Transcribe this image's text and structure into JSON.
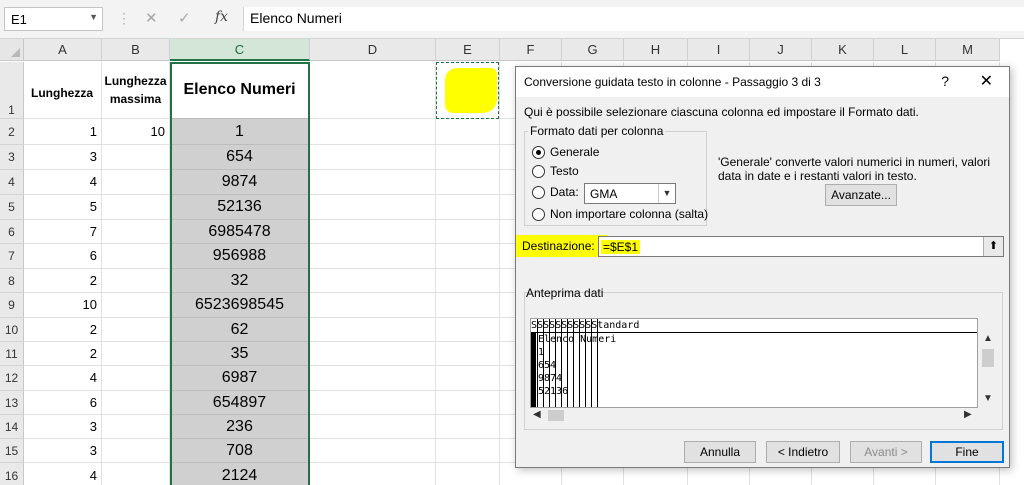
{
  "formula_bar": {
    "name_box": "E1",
    "content": "Elenco Numeri",
    "fx": "fx"
  },
  "columns": [
    "A",
    "B",
    "C",
    "D",
    "E",
    "F",
    "G",
    "H",
    "I",
    "J",
    "K",
    "L",
    "M"
  ],
  "rows": [
    {
      "n": "1",
      "a": "Lunghezza",
      "b": "Lunghezza massima",
      "c": "Elenco Numeri"
    },
    {
      "n": "2",
      "a": "1",
      "b": "10",
      "c": "1"
    },
    {
      "n": "3",
      "a": "3",
      "b": "",
      "c": "654"
    },
    {
      "n": "4",
      "a": "4",
      "b": "",
      "c": "9874"
    },
    {
      "n": "5",
      "a": "5",
      "b": "",
      "c": "52136"
    },
    {
      "n": "6",
      "a": "7",
      "b": "",
      "c": "6985478"
    },
    {
      "n": "7",
      "a": "6",
      "b": "",
      "c": "956988"
    },
    {
      "n": "8",
      "a": "2",
      "b": "",
      "c": "32"
    },
    {
      "n": "9",
      "a": "10",
      "b": "",
      "c": "6523698545"
    },
    {
      "n": "10",
      "a": "2",
      "b": "",
      "c": "62"
    },
    {
      "n": "11",
      "a": "2",
      "b": "",
      "c": "35"
    },
    {
      "n": "12",
      "a": "4",
      "b": "",
      "c": "6987"
    },
    {
      "n": "13",
      "a": "6",
      "b": "",
      "c": "654897"
    },
    {
      "n": "14",
      "a": "3",
      "b": "",
      "c": "236"
    },
    {
      "n": "15",
      "a": "3",
      "b": "",
      "c": "708"
    },
    {
      "n": "16",
      "a": "4",
      "b": "",
      "c": "2124"
    }
  ],
  "dialog": {
    "title": "Conversione guidata testo in colonne - Passaggio 3 di 3",
    "help": "?",
    "close": "✕",
    "instructions": "Qui è possibile selezionare ciascuna colonna ed impostare il Formato dati.",
    "group_title": "Formato dati per colonna",
    "radio_generale": "Generale",
    "radio_testo": "Testo",
    "radio_data": "Data:",
    "radio_skip": "Non importare colonna (salta)",
    "date_format": "GMA",
    "description": "'Generale' converte valori numerici in numeri, valori data in date e i restanti valori in testo.",
    "advanced_button": "Avanzate...",
    "destination_label": "Destinazione:",
    "destination_value": "=$E$1",
    "preview_label": "Anteprima dati",
    "preview_header": "SSSSSSSSSSStandard",
    "preview_lines": [
      "Elenco Numeri",
      "1",
      "654",
      "9874",
      "52136"
    ],
    "cancel_button": "Annulla",
    "back_button": "< Indietro",
    "next_button": "Avanti >",
    "finish_button": "Fine"
  },
  "colors": {
    "excel_green": "#217346",
    "highlight": "#ffff00",
    "selected_column_fill": "#d0d0d0"
  }
}
